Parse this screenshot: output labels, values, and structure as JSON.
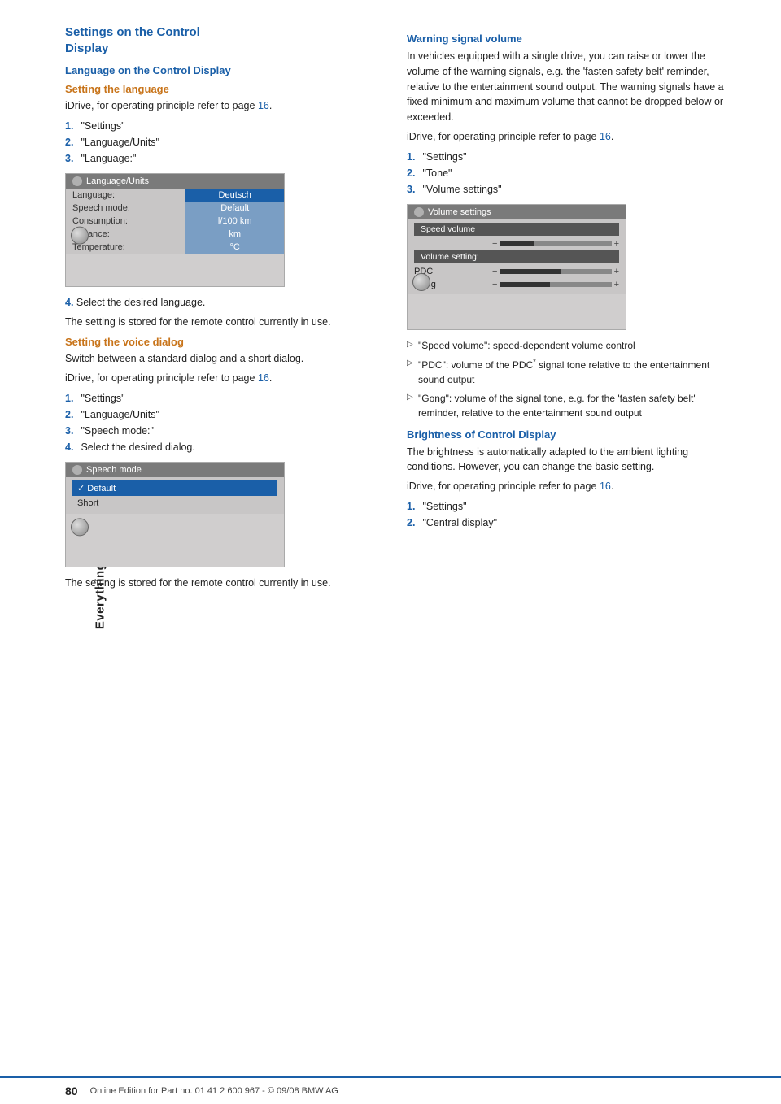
{
  "sidebar": {
    "label": "Everything under control"
  },
  "left": {
    "section_title_line1": "Settings on the Control",
    "section_title_line2": "Display",
    "subsection_lang": "Language on the Control Display",
    "sub_setting_language": "Setting the language",
    "idrive_ref_lang": "iDrive, for operating principle refer to page",
    "idrive_ref_lang_page": "16",
    "lang_steps": [
      {
        "num": "1.",
        "text": "\"Settings\""
      },
      {
        "num": "2.",
        "text": "\"Language/Units\""
      },
      {
        "num": "3.",
        "text": "\"Language:\""
      }
    ],
    "lang_step4": "Select the desired language.",
    "lang_stored": "The setting is stored for the remote control currently in use.",
    "sub_setting_voice": "Setting the voice dialog",
    "voice_desc": "Switch between a standard dialog and a short dialog.",
    "idrive_ref_voice": "iDrive, for operating principle refer to page",
    "idrive_ref_voice_page": "16",
    "voice_steps": [
      {
        "num": "1.",
        "text": "\"Settings\""
      },
      {
        "num": "2.",
        "text": "\"Language/Units\""
      },
      {
        "num": "3.",
        "text": "\"Speech mode:\""
      },
      {
        "num": "4.",
        "text": "Select the desired dialog."
      }
    ],
    "voice_stored": "The setting is stored for the remote control currently in use.",
    "lang_screenshot": {
      "title": "Language/Units",
      "rows": [
        {
          "label": "Language:",
          "value": "Deutsch"
        },
        {
          "label": "Speech mode:",
          "value": "Default"
        },
        {
          "label": "Consumption:",
          "value": "l/100 km"
        },
        {
          "label": "Distance:",
          "value": "km"
        },
        {
          "label": "Temperature:",
          "value": "°C"
        }
      ]
    },
    "speech_screenshot": {
      "title": "Speech mode",
      "items": [
        {
          "text": "✓ Default",
          "selected": true
        },
        {
          "text": "Short",
          "selected": false
        }
      ]
    }
  },
  "right": {
    "warning_title": "Warning signal volume",
    "warning_desc": "In vehicles equipped with a single drive, you can raise or lower the volume of the warning signals, e.g. the 'fasten safety belt' reminder, relative to the entertainment sound output. The warning signals have a fixed minimum and maximum volume that cannot be dropped below or exceeded.",
    "idrive_ref_warn": "iDrive, for operating principle refer to page",
    "idrive_ref_warn_page": "16",
    "warn_steps": [
      {
        "num": "1.",
        "text": "\"Settings\""
      },
      {
        "num": "2.",
        "text": "\"Tone\""
      },
      {
        "num": "3.",
        "text": "\"Volume settings\""
      }
    ],
    "volume_screenshot": {
      "title": "Volume settings",
      "speed_vol_label": "Speed volume",
      "vol_setting_label": "Volume setting:",
      "pdc_label": "PDC",
      "gong_label": "Gong"
    },
    "bullets": [
      "\"Speed volume\": speed-dependent volume control",
      "\"PDC\": volume of the PDC* signal tone relative to the entertainment sound output",
      "\"Gong\": volume of the signal tone, e.g. for the 'fasten safety belt' reminder, relative to the entertainment sound output"
    ],
    "brightness_title": "Brightness of Control Display",
    "brightness_desc": "The brightness is automatically adapted to the ambient lighting conditions. However, you can change the basic setting.",
    "idrive_ref_bright": "iDrive, for operating principle refer to page",
    "idrive_ref_bright_page": "16",
    "bright_steps": [
      {
        "num": "1.",
        "text": "\"Settings\""
      },
      {
        "num": "2.",
        "text": "\"Central display\""
      }
    ]
  },
  "footer": {
    "page_number": "80",
    "text": "Online Edition for Part no. 01 41 2 600 967  - © 09/08 BMW AG"
  }
}
